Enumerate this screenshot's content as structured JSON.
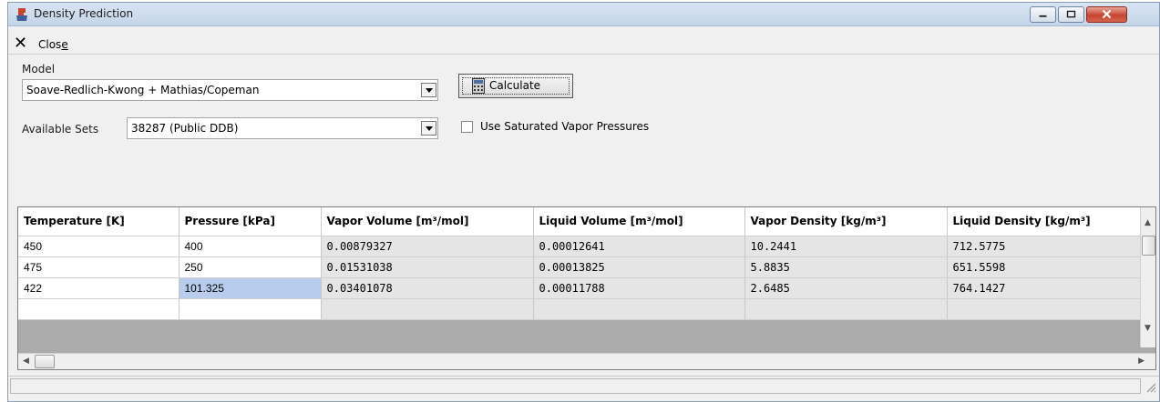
{
  "window": {
    "title": "Density Prediction",
    "accent_color": "#c6452f"
  },
  "toolbar": {
    "close_label_prefix": "Clos",
    "close_label_mnemonic": "e"
  },
  "form": {
    "model_label": "Model",
    "model_value": "Soave-Redlich-Kwong + Mathias/Copeman",
    "sets_label": "Available Sets",
    "sets_value": "38287 (Public DDB)",
    "calculate_label": "Calculate",
    "saturated_label": "Use Saturated Vapor Pressures",
    "saturated_checked": false
  },
  "grid": {
    "columns": [
      "Temperature [K]",
      "Pressure [kPa]",
      "Vapor Volume [m³/mol]",
      "Liquid Volume [m³/mol]",
      "Vapor Density [kg/m³]",
      "Liquid Density [kg/m³]"
    ],
    "rows": [
      [
        "450",
        "400",
        "0.00879327",
        "0.00012641",
        "10.2441",
        "712.5775"
      ],
      [
        "475",
        "250",
        "0.01531038",
        "0.00013825",
        "5.8835",
        "651.5598"
      ],
      [
        "422",
        "101.325",
        "0.03401078",
        "0.00011788",
        "2.6485",
        "764.1427"
      ]
    ],
    "selected_cell": "101.325"
  }
}
